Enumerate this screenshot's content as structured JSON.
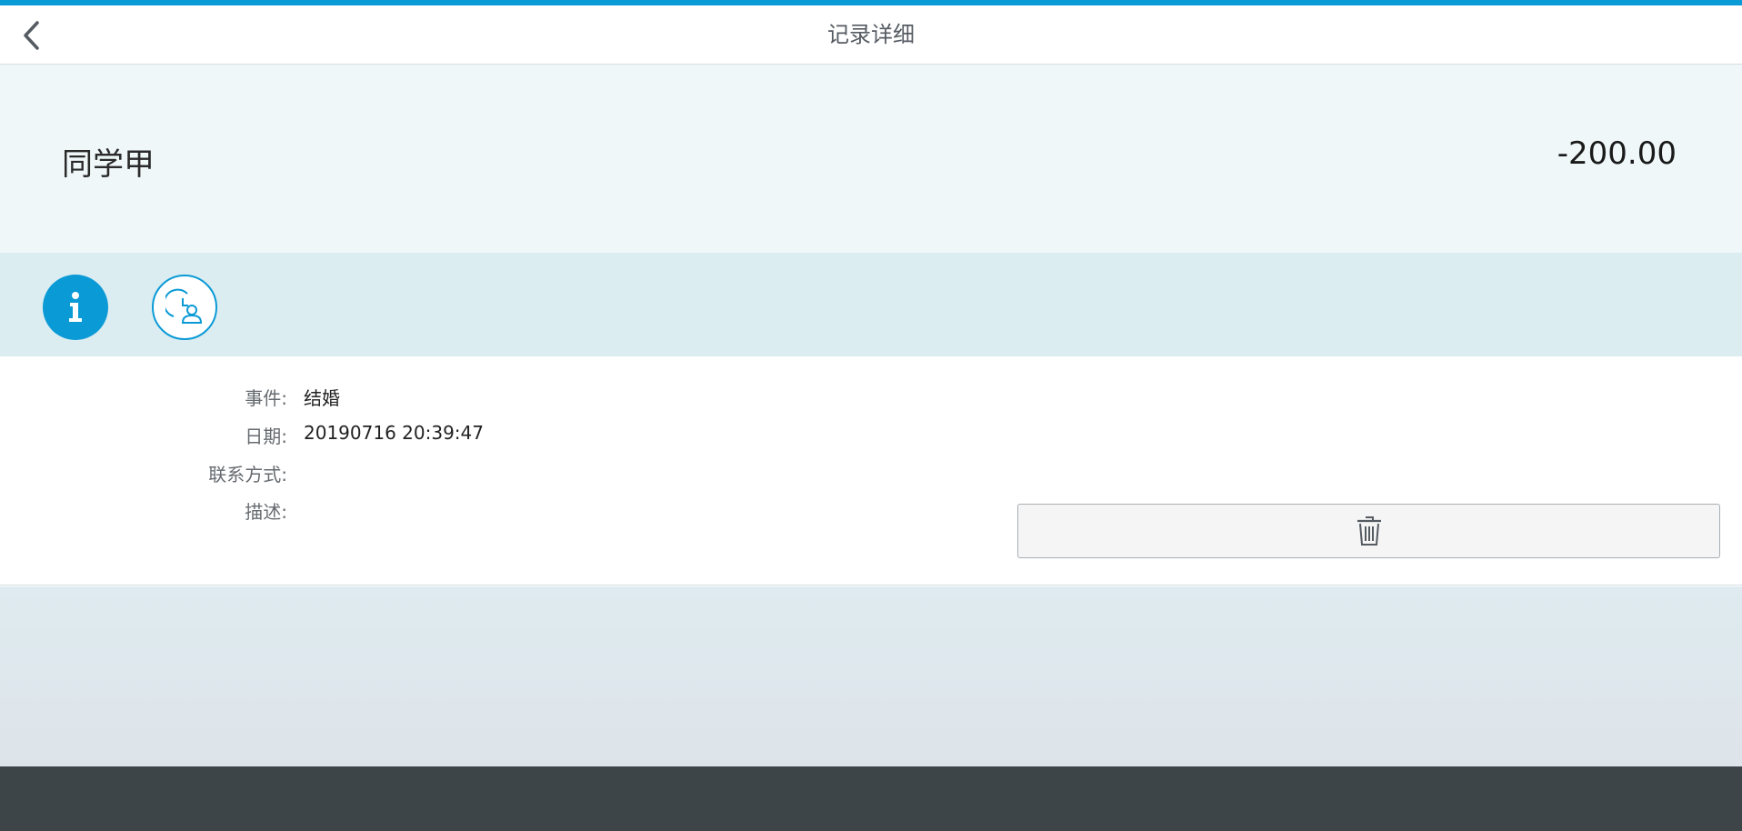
{
  "header": {
    "title": "记录详细",
    "back_icon": "chevron-left-icon"
  },
  "summary": {
    "name": "同学甲",
    "amount": "-200.00"
  },
  "tabs": [
    {
      "icon": "info-icon",
      "selected": true
    },
    {
      "icon": "history-person-icon",
      "selected": false
    }
  ],
  "details": {
    "event_label": "事件:",
    "event_value": "结婚",
    "date_label": "日期:",
    "date_value": "20190716 20:39:47",
    "contact_label": "联系方式:",
    "contact_value": "",
    "description_label": "描述:",
    "description_value": ""
  },
  "actions": {
    "delete_icon": "trash-icon"
  },
  "colors": {
    "accent": "#0a9ad6",
    "footer": "#3e4549"
  }
}
